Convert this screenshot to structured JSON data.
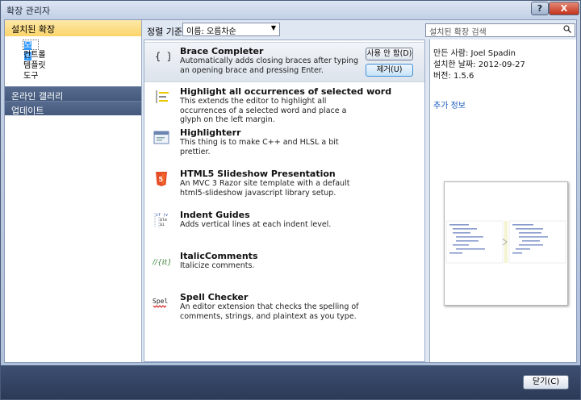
{
  "window": {
    "title": "확장 관리자",
    "help": "?",
    "close": "X"
  },
  "nav": {
    "installed": "설치된 확장",
    "sub_items": [
      "모두",
      "컨트롤",
      "템플릿",
      "도구"
    ],
    "gallery": "온라인 갤러리",
    "updates": "업데이트"
  },
  "toolbar": {
    "sort_label": "정렬 기준:",
    "sort_value": "이름: 오름차순",
    "search_placeholder": "설치된 확장 검색"
  },
  "extensions": [
    {
      "name": "Brace Completer",
      "desc": "Automatically adds closing braces after typing an opening brace and pressing Enter.",
      "icon": "braces-icon"
    },
    {
      "name": "Highlight all occurrences of selected word",
      "desc": "This extends the editor to highlight all occurrences of a selected word and place a glyph on the left margin.",
      "icon": "highlight-icon"
    },
    {
      "name": "Highlighterr",
      "desc": "This thing is to make C++ and HLSL a bit prettier.",
      "icon": "window-icon"
    },
    {
      "name": "HTML5 Slideshow Presentation",
      "desc": "An MVC 3 Razor site template with a default html5-slideshow javascript library setup.",
      "icon": "html5-icon"
    },
    {
      "name": "Indent Guides",
      "desc": "Adds vertical lines at each indent level.",
      "icon": "indent-icon"
    },
    {
      "name": "ItalicComments",
      "desc": "Italicize comments.",
      "icon": "italic-comment-icon"
    },
    {
      "name": "Spell Checker",
      "desc": "An editor extension that checks the spelling of comments, strings, and plaintext as you type.",
      "icon": "spell-icon"
    }
  ],
  "selected_actions": {
    "disable": "사용 안 함(D)",
    "remove": "제거(U)"
  },
  "detail": {
    "author_label": "만든 사람:",
    "author": "Joel Spadin",
    "date_label": "설치한 날짜:",
    "date": "2012-09-27",
    "version_label": "버전:",
    "version": "1.5.6",
    "more_info": "추가 정보"
  },
  "footer": {
    "close": "닫기(C)"
  }
}
